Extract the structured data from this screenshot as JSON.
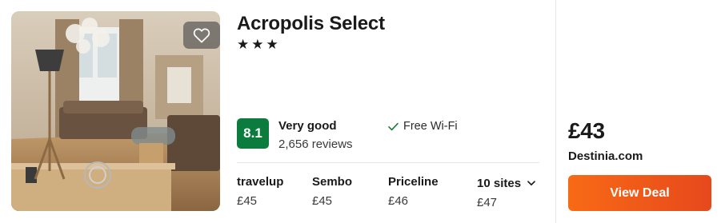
{
  "hotel": {
    "name": "Acropolis Select",
    "stars_text": "★★★",
    "favorite_icon": "heart-icon"
  },
  "rating": {
    "score": "8.1",
    "label": "Very good",
    "reviews": "2,656 reviews",
    "badge_color": "#0b7c3e"
  },
  "amenities": [
    {
      "icon": "check-icon",
      "label": "Free Wi-Fi"
    }
  ],
  "providers": [
    {
      "name": "travelup",
      "price": "£45"
    },
    {
      "name": "Sembo",
      "price": "£45"
    },
    {
      "name": "Priceline",
      "price": "£46"
    },
    {
      "name": "10 sites",
      "price": "£47",
      "icon": "chevron-down-icon"
    }
  ],
  "deal": {
    "price": "£43",
    "provider": "Destinia.com",
    "button_label": "View Deal",
    "button_color": "#f2621a"
  }
}
